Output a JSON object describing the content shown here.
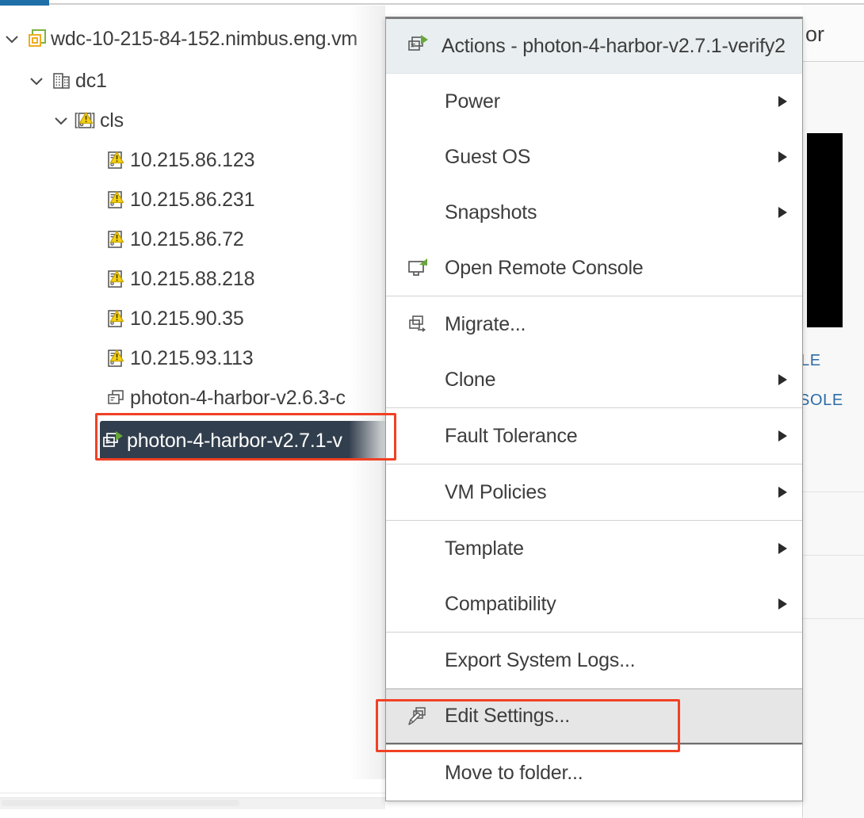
{
  "window": {
    "active_tab_accent": "#1f6fa9",
    "selection_color": "#313e4d",
    "annotation_color": "#f04124",
    "link_color": "#2c6ba8"
  },
  "right_pane": {
    "title_fragment": "or",
    "links": [
      {
        "text": "LE",
        "name": "launch-console-link-fragment"
      },
      {
        "text": "SOLE",
        "name": "open-remote-console-link-fragment"
      }
    ]
  },
  "inventory_tree": {
    "nodes": [
      {
        "label": "wdc-10-215-84-152.nimbus.eng.vm",
        "icon": "vcenter-icon",
        "level": 0,
        "expanded": true,
        "selected": false
      },
      {
        "label": "dc1",
        "icon": "datacenter-icon",
        "level": 1,
        "expanded": true,
        "selected": false
      },
      {
        "label": "cls",
        "icon": "cluster-warning-icon",
        "level": 2,
        "expanded": true,
        "selected": false
      },
      {
        "label": "10.215.86.123",
        "icon": "host-warning-icon",
        "level": 3,
        "expanded": null,
        "selected": false
      },
      {
        "label": "10.215.86.231",
        "icon": "host-warning-icon",
        "level": 3,
        "expanded": null,
        "selected": false
      },
      {
        "label": "10.215.86.72",
        "icon": "host-warning-icon",
        "level": 3,
        "expanded": null,
        "selected": false
      },
      {
        "label": "10.215.88.218",
        "icon": "host-warning-icon",
        "level": 3,
        "expanded": null,
        "selected": false
      },
      {
        "label": "10.215.90.35",
        "icon": "host-warning-icon",
        "level": 3,
        "expanded": null,
        "selected": false
      },
      {
        "label": "10.215.93.113",
        "icon": "host-warning-icon",
        "level": 3,
        "expanded": null,
        "selected": false
      },
      {
        "label": "photon-4-harbor-v2.6.3-c",
        "icon": "vm-icon",
        "level": 3,
        "expanded": null,
        "selected": false
      },
      {
        "label": "photon-4-harbor-v2.7.1-v",
        "icon": "vm-running-icon",
        "level": 3,
        "expanded": null,
        "selected": true
      }
    ]
  },
  "context_menu": {
    "header": {
      "label": "Actions - photon-4-harbor-v2.7.1-verify2",
      "icon": "vm-running-icon"
    },
    "groups": [
      {
        "items": [
          {
            "label": "Power",
            "icon": null,
            "submenu": true,
            "highlighted": false
          },
          {
            "label": "Guest OS",
            "icon": null,
            "submenu": true,
            "highlighted": false
          },
          {
            "label": "Snapshots",
            "icon": null,
            "submenu": true,
            "highlighted": false
          },
          {
            "label": "Open Remote Console",
            "icon": "remote-console-icon",
            "submenu": false,
            "highlighted": false
          }
        ]
      },
      {
        "items": [
          {
            "label": "Migrate...",
            "icon": "migrate-icon",
            "submenu": false,
            "highlighted": false
          },
          {
            "label": "Clone",
            "icon": null,
            "submenu": true,
            "highlighted": false
          }
        ]
      },
      {
        "items": [
          {
            "label": "Fault Tolerance",
            "icon": null,
            "submenu": true,
            "highlighted": false
          }
        ]
      },
      {
        "items": [
          {
            "label": "VM Policies",
            "icon": null,
            "submenu": true,
            "highlighted": false
          }
        ]
      },
      {
        "items": [
          {
            "label": "Template",
            "icon": null,
            "submenu": true,
            "highlighted": false
          },
          {
            "label": "Compatibility",
            "icon": null,
            "submenu": true,
            "highlighted": false
          }
        ]
      },
      {
        "items": [
          {
            "label": "Export System Logs...",
            "icon": null,
            "submenu": false,
            "highlighted": false
          }
        ]
      },
      {
        "items": [
          {
            "label": "Edit Settings...",
            "icon": "edit-settings-icon",
            "submenu": false,
            "highlighted": true
          }
        ]
      },
      {
        "items": [
          {
            "label": "Move to folder...",
            "icon": null,
            "submenu": false,
            "highlighted": false
          }
        ]
      }
    ]
  }
}
